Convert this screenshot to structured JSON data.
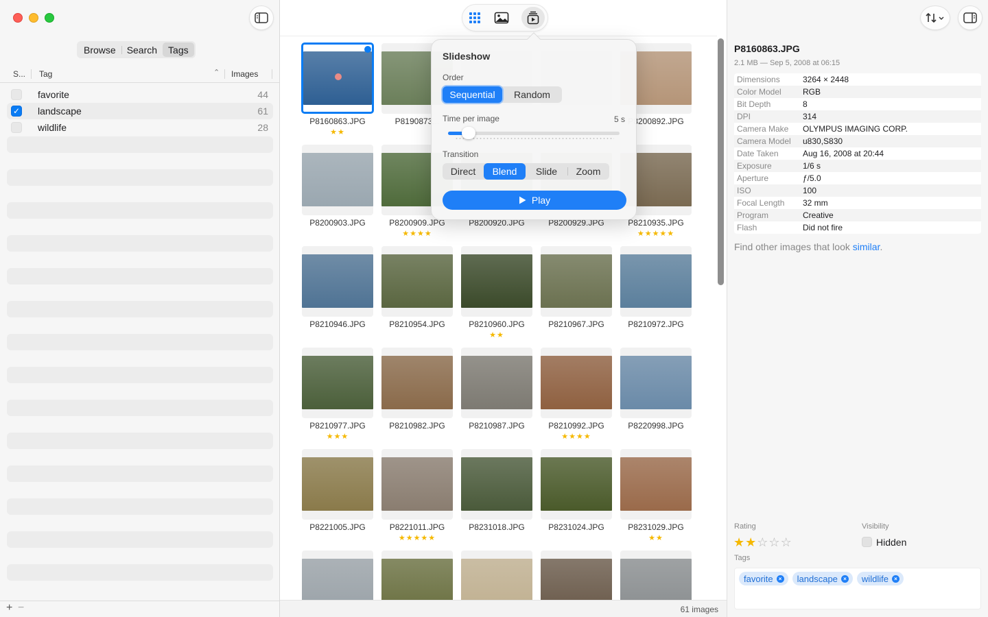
{
  "sidebar": {
    "modes": [
      "Browse",
      "Search",
      "Tags"
    ],
    "active_mode": "Tags",
    "columns": {
      "selected": "S...",
      "tag": "Tag",
      "images": "Images"
    },
    "tags": [
      {
        "name": "favorite",
        "count": "44",
        "checked": false
      },
      {
        "name": "landscape",
        "count": "61",
        "checked": true
      },
      {
        "name": "wildlife",
        "count": "28",
        "checked": false
      }
    ],
    "footer": {
      "add": "+",
      "remove": "−"
    }
  },
  "main": {
    "footer_count": "61 images",
    "thumbnails": [
      {
        "name": "P8160863.JPG",
        "stars": "★★",
        "color": "#2e5f93"
      },
      {
        "name": "P8190873...",
        "stars": "",
        "color": "#6b7f5a"
      },
      {
        "name": "",
        "stars": "",
        "color": "#cccccc"
      },
      {
        "name": "",
        "stars": "",
        "color": "#cccccc"
      },
      {
        "name": "P8200892.JPG",
        "stars": "",
        "color": "#b59578"
      },
      {
        "name": "P8200903.JPG",
        "stars": "",
        "color": "#9aa7b0"
      },
      {
        "name": "P8200909.JPG",
        "stars": "★★★★",
        "color": "#4f6b3b"
      },
      {
        "name": "P8200920.JPG",
        "stars": "",
        "color": "#7d8a6a"
      },
      {
        "name": "P8200929.JPG",
        "stars": "",
        "color": "#879273"
      },
      {
        "name": "P8210935.JPG",
        "stars": "★★★★★",
        "color": "#7a6a52"
      },
      {
        "name": "P8210946.JPG",
        "stars": "",
        "color": "#4f7394"
      },
      {
        "name": "P8210954.JPG",
        "stars": "",
        "color": "#5a6640"
      },
      {
        "name": "P8210960.JPG",
        "stars": "★★",
        "color": "#3b4a2a"
      },
      {
        "name": "P8210967.JPG",
        "stars": "",
        "color": "#6b7150"
      },
      {
        "name": "P8210972.JPG",
        "stars": "",
        "color": "#5b7f9c"
      },
      {
        "name": "P8210977.JPG",
        "stars": "★★★",
        "color": "#4b5f3a"
      },
      {
        "name": "P8210982.JPG",
        "stars": "",
        "color": "#8a6a4a"
      },
      {
        "name": "P8210987.JPG",
        "stars": "",
        "color": "#7d7a72"
      },
      {
        "name": "P8210992.JPG",
        "stars": "★★★★",
        "color": "#8f6040"
      },
      {
        "name": "P8220998.JPG",
        "stars": "",
        "color": "#6a8aa8"
      },
      {
        "name": "P8221005.JPG",
        "stars": "",
        "color": "#8a7a4a"
      },
      {
        "name": "P8221011.JPG",
        "stars": "★★★★★",
        "color": "#8a7d70"
      },
      {
        "name": "P8231018.JPG",
        "stars": "",
        "color": "#4a5a3a"
      },
      {
        "name": "P8231024.JPG",
        "stars": "",
        "color": "#4a5a2a"
      },
      {
        "name": "P8231029.JPG",
        "stars": "★★",
        "color": "#9a6a4a"
      },
      {
        "name": "",
        "stars": "",
        "color": "#9aa2a8"
      },
      {
        "name": "",
        "stars": "",
        "color": "#6a7040"
      },
      {
        "name": "",
        "stars": "",
        "color": "#c0b090"
      },
      {
        "name": "",
        "stars": "",
        "color": "#6a5a4a"
      },
      {
        "name": "",
        "stars": "",
        "color": "#8a8e90"
      }
    ]
  },
  "slideshow": {
    "title": "Slideshow",
    "order_label": "Order",
    "order_options": [
      "Sequential",
      "Random"
    ],
    "order_selected": "Sequential",
    "time_label": "Time per image",
    "time_value": "5 s",
    "time_fraction": 0.08,
    "transition_label": "Transition",
    "transition_options": [
      "Direct",
      "Blend",
      "Slide",
      "Zoom"
    ],
    "transition_selected": "Blend",
    "play_label": "Play"
  },
  "inspector": {
    "filename": "P8160863.JPG",
    "subtitle": "2.1 MB — Sep 5, 2008 at 06:15",
    "metadata": [
      [
        "Dimensions",
        "3264 × 2448"
      ],
      [
        "Color Model",
        "RGB"
      ],
      [
        "Bit Depth",
        "8"
      ],
      [
        "DPI",
        "314"
      ],
      [
        "Camera Make",
        "OLYMPUS IMAGING CORP."
      ],
      [
        "Camera Model",
        "u830,S830"
      ],
      [
        "Date Taken",
        "Aug 16, 2008 at 20:44"
      ],
      [
        "Exposure",
        "1/6 s"
      ],
      [
        "Aperture",
        "ƒ/5.0"
      ],
      [
        "ISO",
        "100"
      ],
      [
        "Focal Length",
        "32 mm"
      ],
      [
        "Program",
        "Creative"
      ],
      [
        "Flash",
        "Did not fire"
      ]
    ],
    "similar_prefix": "Find other images that look ",
    "similar_link": "similar",
    "similar_suffix": ".",
    "rating_label": "Rating",
    "rating_value": 2,
    "rating_max": 5,
    "visibility_label": "Visibility",
    "hidden_label": "Hidden",
    "tags_label": "Tags",
    "tags": [
      "favorite",
      "landscape",
      "wildlife"
    ]
  },
  "icons": {
    "sidebar_toggle": "sidebar-left-icon",
    "grid": "grid-icon",
    "photo": "photo-icon",
    "slideshow": "slideshow-icon",
    "sort": "sort-icon",
    "inspector_toggle": "sidebar-right-icon"
  },
  "colors": {
    "accent": "#1f7ff7",
    "star": "#f5b800"
  }
}
